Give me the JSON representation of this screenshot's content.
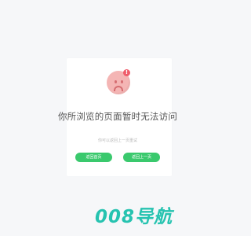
{
  "error": {
    "title": "你所浏览的页面暂时无法访问",
    "description": "你可以返回上一页重试",
    "badge": "!"
  },
  "buttons": {
    "left": "返回首页",
    "right": "返回上一页"
  },
  "brand": {
    "text": "008导航"
  },
  "colors": {
    "background": "#f6f7f9",
    "button": "#3ac96d",
    "brand": "#26c3b0",
    "face": "#f4b5b4",
    "badge": "#ef5d6a"
  },
  "icons": {
    "face": "sad-face-icon"
  }
}
